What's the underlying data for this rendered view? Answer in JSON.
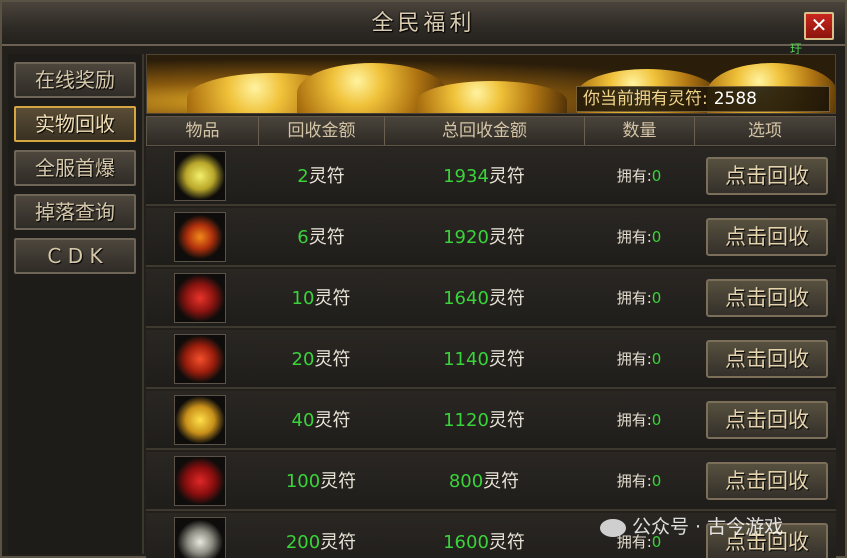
{
  "window": {
    "title": "全民福利",
    "close_label": "✕",
    "corner_tag": "玗"
  },
  "sidebar": {
    "items": [
      {
        "label": "在线奖励",
        "active": false
      },
      {
        "label": "实物回收",
        "active": true
      },
      {
        "label": "全服首爆",
        "active": false
      },
      {
        "label": "掉落查询",
        "active": false
      },
      {
        "label": "C D K",
        "active": false
      }
    ]
  },
  "banner": {
    "balance_label": "你当前拥有灵符:",
    "balance_value": "2588"
  },
  "table": {
    "headers": [
      "物品",
      "回收金额",
      "总回收金额",
      "数量",
      "选项"
    ],
    "rows": [
      {
        "icon": "gold-bar-item-icon",
        "amount": "2",
        "total": "1934",
        "owned_label": "拥有:",
        "owned": "0",
        "button": "点击回收"
      },
      {
        "icon": "bottle-item-icon",
        "amount": "6",
        "total": "1920",
        "owned_label": "拥有:",
        "owned": "0",
        "button": "点击回收"
      },
      {
        "icon": "red-can-item-icon",
        "amount": "10",
        "total": "1640",
        "owned_label": "拥有:",
        "owned": "0",
        "button": "点击回收"
      },
      {
        "icon": "red-pouch-item-icon",
        "amount": "20",
        "total": "1140",
        "owned_label": "拥有:",
        "owned": "0",
        "button": "点击回收"
      },
      {
        "icon": "gold-can-item-icon",
        "amount": "40",
        "total": "1120",
        "owned_label": "拥有:",
        "owned": "0",
        "button": "点击回收"
      },
      {
        "icon": "red-box-item-icon",
        "amount": "100",
        "total": "800",
        "owned_label": "拥有:",
        "owned": "0",
        "button": "点击回收"
      },
      {
        "icon": "silver-can-item-icon",
        "amount": "200",
        "total": "1600",
        "owned_label": "拥有:",
        "owned": "0",
        "button": "点击回收"
      }
    ],
    "unit": "灵符"
  },
  "watermark": {
    "text": "公众号 · 古今游戏"
  }
}
